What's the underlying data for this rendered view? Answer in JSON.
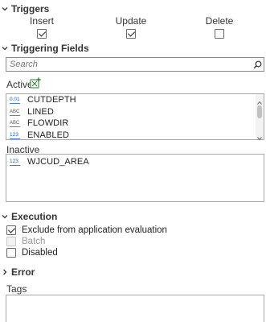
{
  "triggers": {
    "header": "Triggers",
    "insert": {
      "label": "Insert",
      "checked": true
    },
    "update": {
      "label": "Update",
      "checked": true
    },
    "delete": {
      "label": "Delete",
      "checked": false
    }
  },
  "triggering_fields": {
    "header": "Triggering Fields",
    "search": {
      "placeholder": "Search",
      "value": ""
    },
    "active_label": "Active",
    "active_fields": [
      {
        "type_glyph": "0.01",
        "type": "double",
        "name": "CUTDEPTH"
      },
      {
        "type_glyph": "ABC",
        "type": "text",
        "name": "LINED"
      },
      {
        "type_glyph": "ABC",
        "type": "text",
        "name": "FLOWDIR"
      },
      {
        "type_glyph": "123",
        "type": "integer",
        "name": "ENABLED"
      }
    ],
    "inactive_label": "Inactive",
    "inactive_fields": [
      {
        "type_glyph": "123",
        "type": "integer",
        "name": "WJCUD_AREA"
      }
    ]
  },
  "execution": {
    "header": "Execution",
    "exclude_from_app_eval": {
      "label": "Exclude from application evaluation",
      "checked": true,
      "enabled": true
    },
    "batch": {
      "label": "Batch",
      "checked": false,
      "enabled": false
    },
    "disabled": {
      "label": "Disabled",
      "checked": false,
      "enabled": true
    }
  },
  "error": {
    "header": "Error",
    "expanded": false
  },
  "tags": {
    "label": "Tags",
    "value": ""
  }
}
